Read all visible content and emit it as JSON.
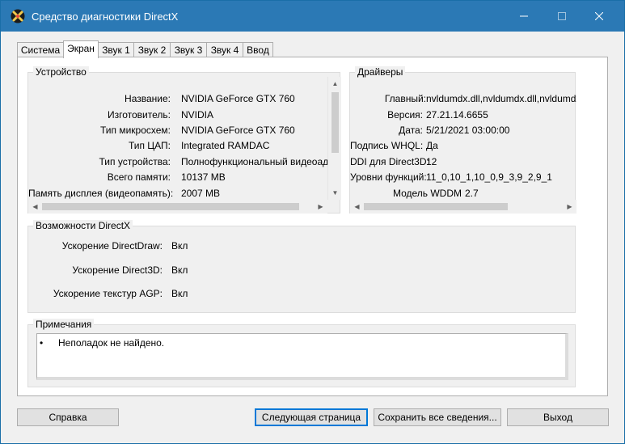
{
  "window": {
    "title": "Средство диагностики DirectX",
    "controls": {
      "minimize": "—",
      "maximize": "☐",
      "close": "✕"
    }
  },
  "tabs": [
    "Система",
    "Экран",
    "Звук 1",
    "Звук 2",
    "Звук 3",
    "Звук 4",
    "Ввод"
  ],
  "active_tab": "Экран",
  "device": {
    "title": "Устройство",
    "rows": [
      {
        "label": "Название:",
        "value": "NVIDIA GeForce GTX 760"
      },
      {
        "label": "Изготовитель:",
        "value": "NVIDIA"
      },
      {
        "label": "Тип микросхем:",
        "value": "NVIDIA GeForce GTX 760"
      },
      {
        "label": "Тип ЦАП:",
        "value": "Integrated RAMDAC"
      },
      {
        "label": "Тип устройства:",
        "value": "Полнофункциональный видеоадап"
      },
      {
        "label": "Всего памяти:",
        "value": "10137 MB"
      },
      {
        "label": "Память дисплея (видеопамять):",
        "value": "2007 MB"
      }
    ]
  },
  "drivers": {
    "title": "Драйверы",
    "rows": [
      {
        "label": "Главный:",
        "value": "nvldumdx.dll,nvldumdx.dll,nvldumdx.d"
      },
      {
        "label": "Версия:",
        "value": "27.21.14.6655"
      },
      {
        "label": "Дата:",
        "value": "5/21/2021 03:00:00"
      },
      {
        "label": "Подпись WHQL:",
        "value": "Да"
      },
      {
        "label": "DDI для Direct3D:",
        "value": "12"
      },
      {
        "label": "Уровни функций:",
        "value": "11_0,10_1,10_0,9_3,9_2,9_1"
      },
      {
        "label": "Модель WDDM",
        "value": "2.7"
      }
    ]
  },
  "features": {
    "title": "Возможности DirectX",
    "rows": [
      {
        "label": "Ускорение DirectDraw:",
        "value": "Вкл"
      },
      {
        "label": "Ускорение Direct3D:",
        "value": "Вкл"
      },
      {
        "label": "Ускорение текстур AGP:",
        "value": "Вкл"
      }
    ]
  },
  "notes": {
    "title": "Примечания",
    "bullet": "•",
    "text": "Неполадок не найдено."
  },
  "buttons": {
    "help": "Справка",
    "next_page": "Следующая страница",
    "save_all": "Сохранить все сведения...",
    "exit": "Выход"
  },
  "colors": {
    "titlebar": "#2b79b5",
    "accent_focus": "#0078d7",
    "window_bg": "#f0f0f0"
  }
}
